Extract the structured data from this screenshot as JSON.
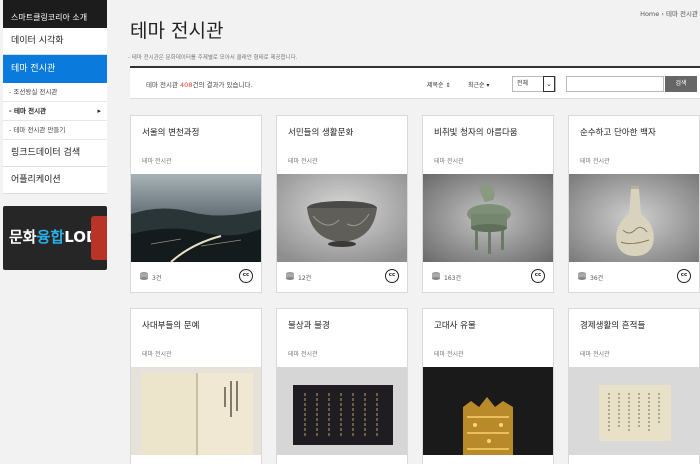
{
  "sidebar": {
    "top": "스마트클링코리아 소개",
    "items": [
      {
        "label": "데이터 시각화"
      },
      {
        "label": "테마 전시관"
      }
    ],
    "subitems": [
      {
        "label": "- 조선왕실 전시관"
      },
      {
        "label": "- 테마 전시관"
      },
      {
        "label": "- 테마 전시관 만들기"
      }
    ],
    "items2": [
      {
        "label": "링크드데이터 검색"
      },
      {
        "label": "어플리케이션"
      }
    ],
    "banner": {
      "part1": "문화",
      "part2": "융합",
      "part3": "LOD"
    }
  },
  "breadcrumb": {
    "home": "Home",
    "sep": "›",
    "current": "테마 전시관"
  },
  "page": {
    "title": "테마 전시관",
    "desc": "- 테마 전시관은 문화데이터를 주제별로 모아서 클래언 형태로 제공합니다."
  },
  "results": {
    "prefix": "테마 전시관 ",
    "count": "408",
    "suffix": "건의 결과가 있습니다.",
    "sort1": "제목순 ⇕",
    "sort2": "최근순 ▾",
    "select": "전체",
    "search_button": "검색"
  },
  "cards": [
    {
      "title": "서울의 변천과정",
      "category": "테마 전시관",
      "count": "3건"
    },
    {
      "title": "서민들의 생활문화",
      "category": "테마 전시관",
      "count": "12건"
    },
    {
      "title": "비취빛 청자의 아름다움",
      "category": "테마 전시관",
      "count": "163건"
    },
    {
      "title": "순수하고 단아한 백자",
      "category": "테마 전시관",
      "count": "36건"
    },
    {
      "title": "사대부들의 문예",
      "category": "테마 전시관",
      "count": ""
    },
    {
      "title": "불상과 불경",
      "category": "테마 전시관",
      "count": ""
    },
    {
      "title": "고대사 유물",
      "category": "테마 전시관",
      "count": ""
    },
    {
      "title": "경제생활의 흔적들",
      "category": "테마 전시관",
      "count": ""
    }
  ],
  "icons": {
    "coin": "coin-stack-icon",
    "license": "creative-commons-icon",
    "cc": "cc"
  }
}
